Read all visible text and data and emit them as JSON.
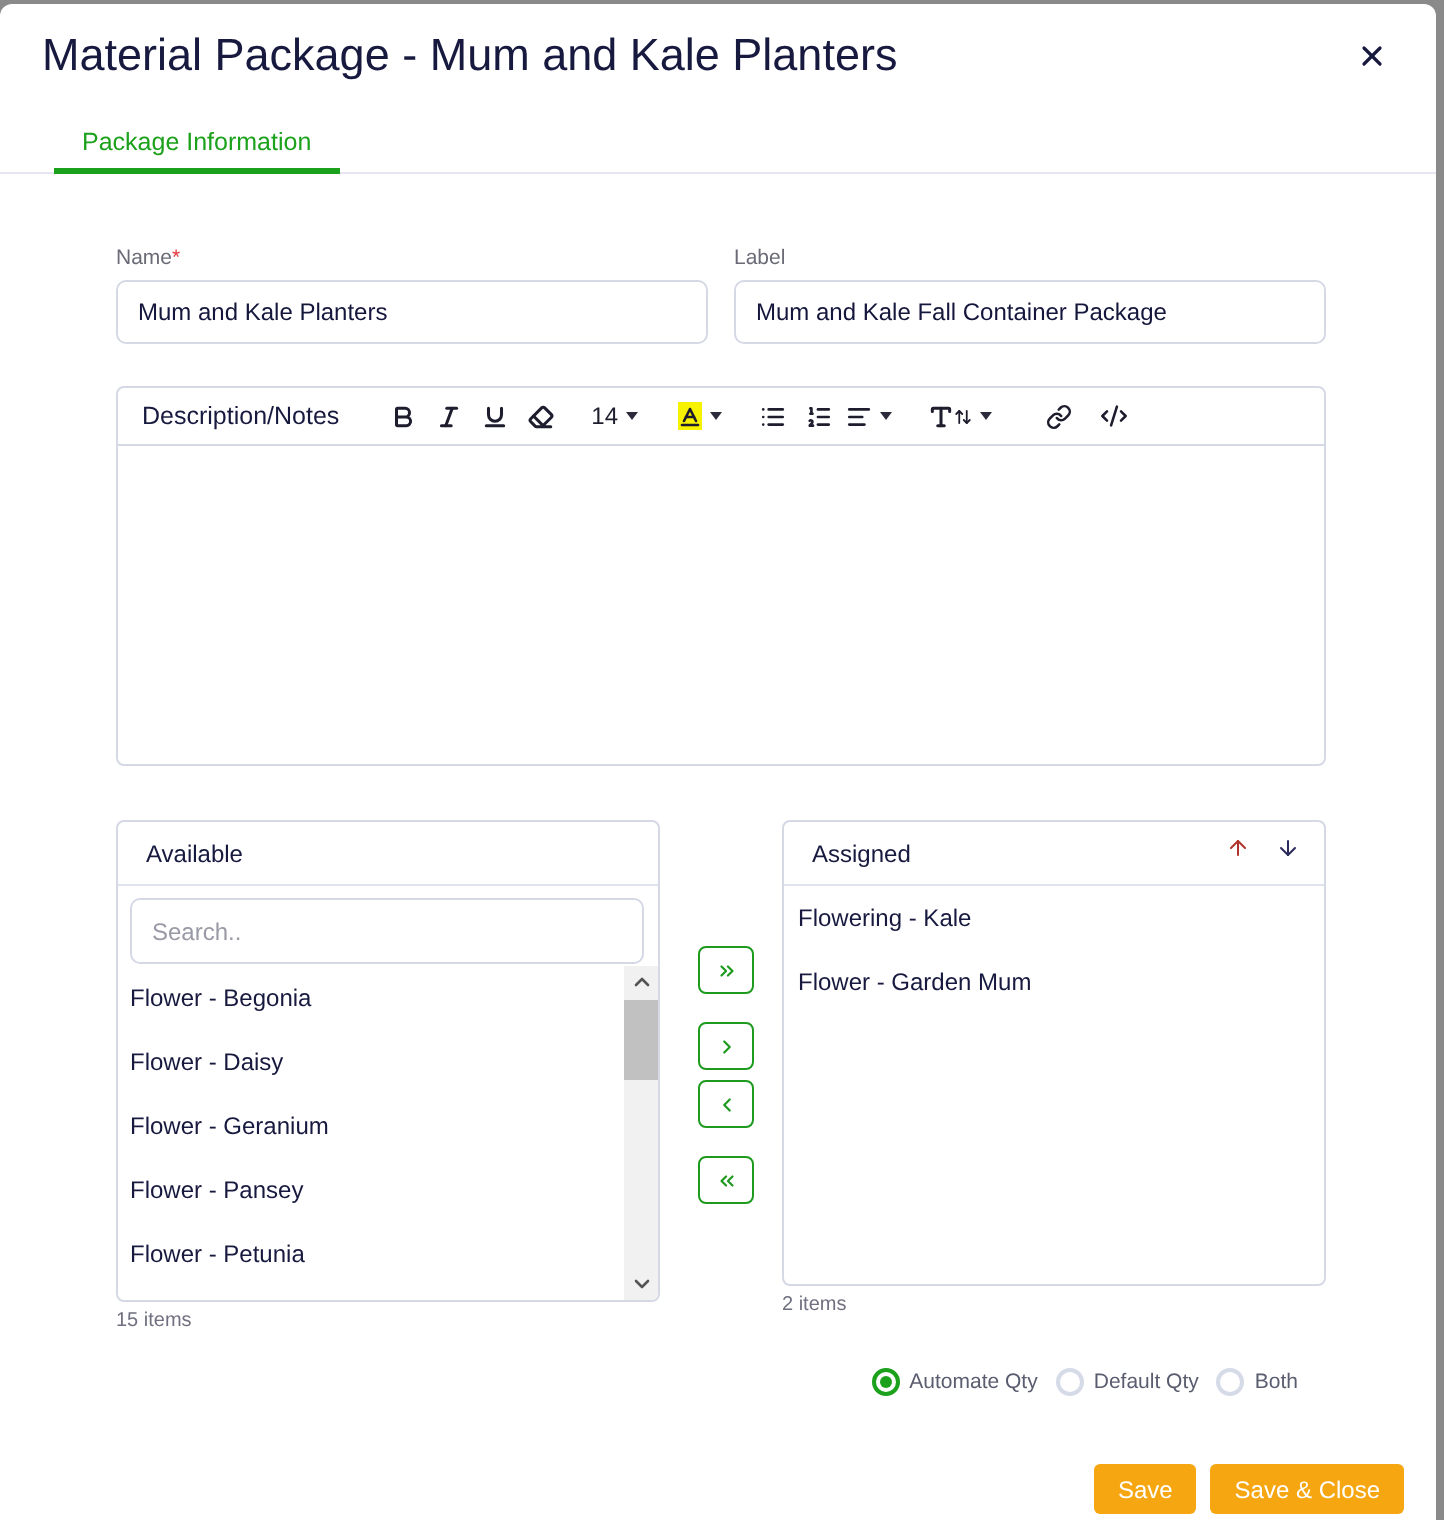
{
  "dialog": {
    "title": "Material Package - Mum and Kale Planters"
  },
  "tabs": [
    {
      "label": "Package Information",
      "selected": true
    }
  ],
  "fields": [
    {
      "label": "Name",
      "required_mark": "*",
      "value": "Mum and Kale Planters"
    },
    {
      "label": "Label",
      "value": "Mum and Kale Fall Container Package"
    }
  ],
  "editor": {
    "label": "Description/Notes",
    "font_size": "14"
  },
  "available": {
    "title": "Available",
    "search": {
      "placeholder": "Search.."
    },
    "items": [
      "Flower - Begonia",
      "Flower - Daisy",
      "Flower - Geranium",
      "Flower - Pansey",
      "Flower - Petunia"
    ],
    "count": "15 items"
  },
  "assigned": {
    "title": "Assigned",
    "items": [
      "Flowering - Kale",
      "Flower - Garden Mum"
    ],
    "count": "2 items"
  },
  "quantity_options": [
    {
      "label": "Automate Qty",
      "selected": true
    },
    {
      "label": "Default Qty",
      "selected": false
    },
    {
      "label": "Both",
      "selected": false
    }
  ],
  "buttons": [
    {
      "label": "Save"
    },
    {
      "label": "Save & Close"
    }
  ]
}
